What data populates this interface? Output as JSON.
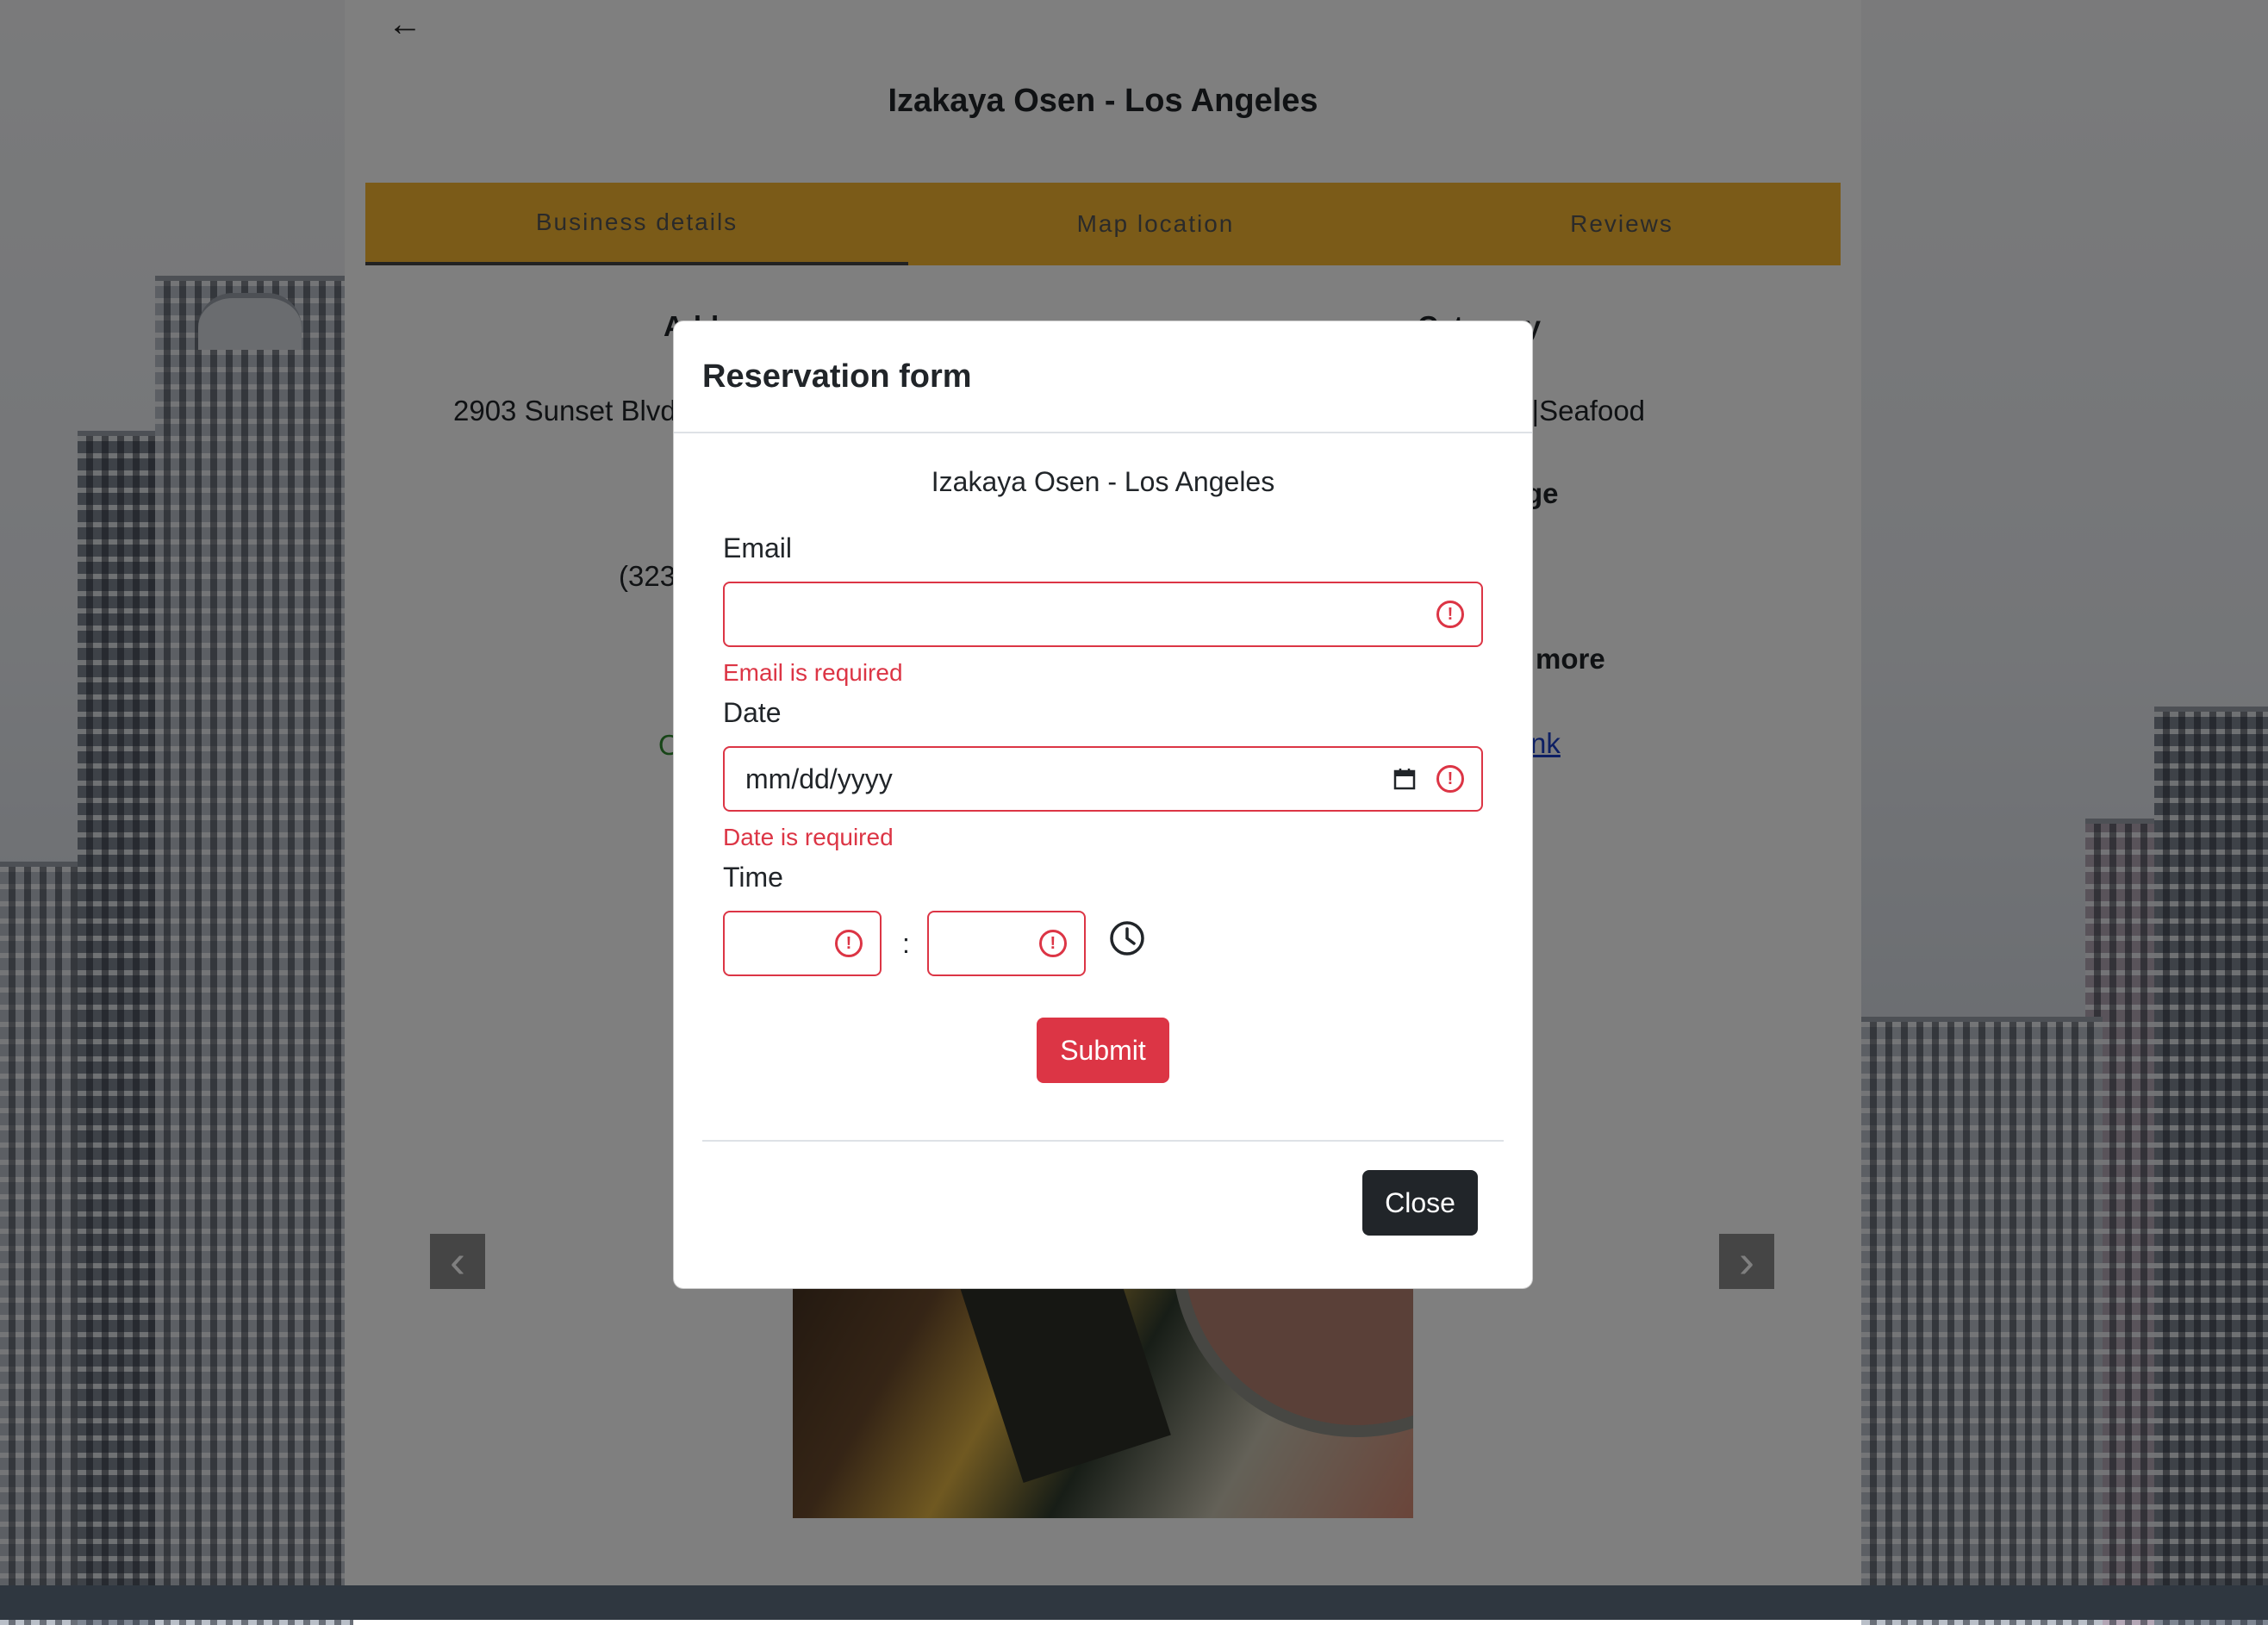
{
  "page": {
    "title": "Izakaya Osen - Los Angeles",
    "back_icon": "arrow-left-icon"
  },
  "tabs": [
    {
      "label": "Business details",
      "active": true
    },
    {
      "label": "Map location",
      "active": false
    },
    {
      "label": "Reviews",
      "active": false
    }
  ],
  "details": {
    "address_heading": "Address",
    "address": "2903 Sunset Blvd",
    "phone": "(323",
    "category_heading": "Category",
    "category": "a |Seafood",
    "price_heading": "ge",
    "more_heading": "more",
    "link_text": "nk",
    "open_status": "O"
  },
  "modal": {
    "title": "Reservation form",
    "restaurant_name": "Izakaya Osen - Los Angeles",
    "email": {
      "label": "Email",
      "value": "",
      "error": "Email is required"
    },
    "date": {
      "label": "Date",
      "placeholder": "mm/dd/yyyy",
      "error": "Date is required"
    },
    "time": {
      "label": "Time",
      "separator": ":"
    },
    "submit_label": "Submit",
    "close_label": "Close"
  },
  "colors": {
    "tab_bar": "#f7b731",
    "error": "#dc3545",
    "close_button": "#212529"
  },
  "carousel": {
    "prev_icon": "chevron-left-icon",
    "next_icon": "chevron-right-icon"
  }
}
